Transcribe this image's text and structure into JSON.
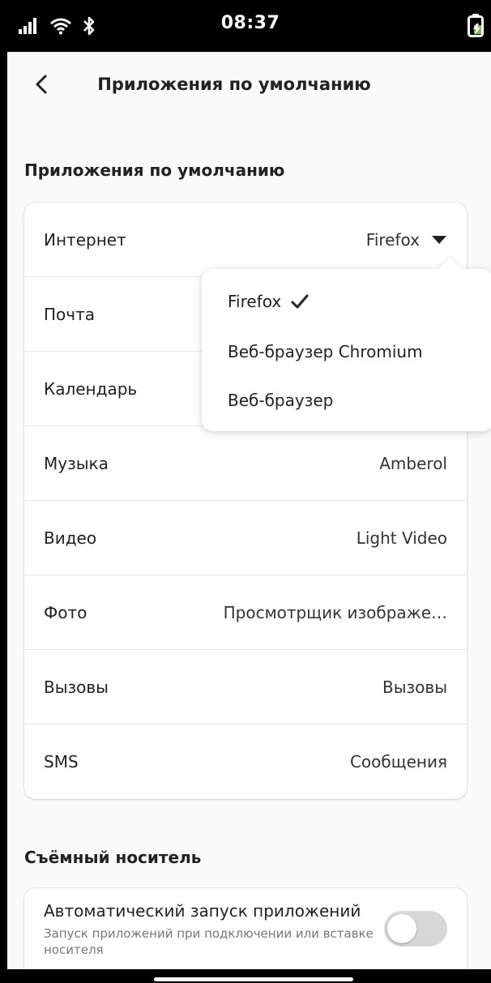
{
  "status_bar": {
    "time": "08:37",
    "icons": [
      "signal-icon",
      "wifi-icon",
      "bluetooth-icon",
      "battery-charging-icon"
    ]
  },
  "header": {
    "title": "Приложения по умолчанию"
  },
  "default_apps": {
    "section_title": "Приложения по умолчанию",
    "rows": [
      {
        "label": "Интернет",
        "value": "Firefox"
      },
      {
        "label": "Почта",
        "value": ""
      },
      {
        "label": "Календарь",
        "value": ""
      },
      {
        "label": "Музыка",
        "value": "Amberol"
      },
      {
        "label": "Видео",
        "value": "Light Video"
      },
      {
        "label": "Фото",
        "value": "Просмотрщик изображе…"
      },
      {
        "label": "Вызовы",
        "value": "Вызовы"
      },
      {
        "label": "SMS",
        "value": "Сообщения"
      }
    ]
  },
  "dropdown": {
    "options": [
      {
        "label": "Firefox",
        "selected": true
      },
      {
        "label": "Веб-браузер Chromium",
        "selected": false
      },
      {
        "label": "Веб-браузер",
        "selected": false
      }
    ]
  },
  "removable_media": {
    "section_title": "Съёмный носитель",
    "autorun": {
      "title": "Автоматический запуск приложений",
      "subtitle": "Запуск приложений при подключении или вставке носителя",
      "enabled": false
    }
  },
  "colors": {
    "background": "#fafafa",
    "card": "#ffffff",
    "text": "#222222",
    "switch_off": "#d7d7d7"
  }
}
